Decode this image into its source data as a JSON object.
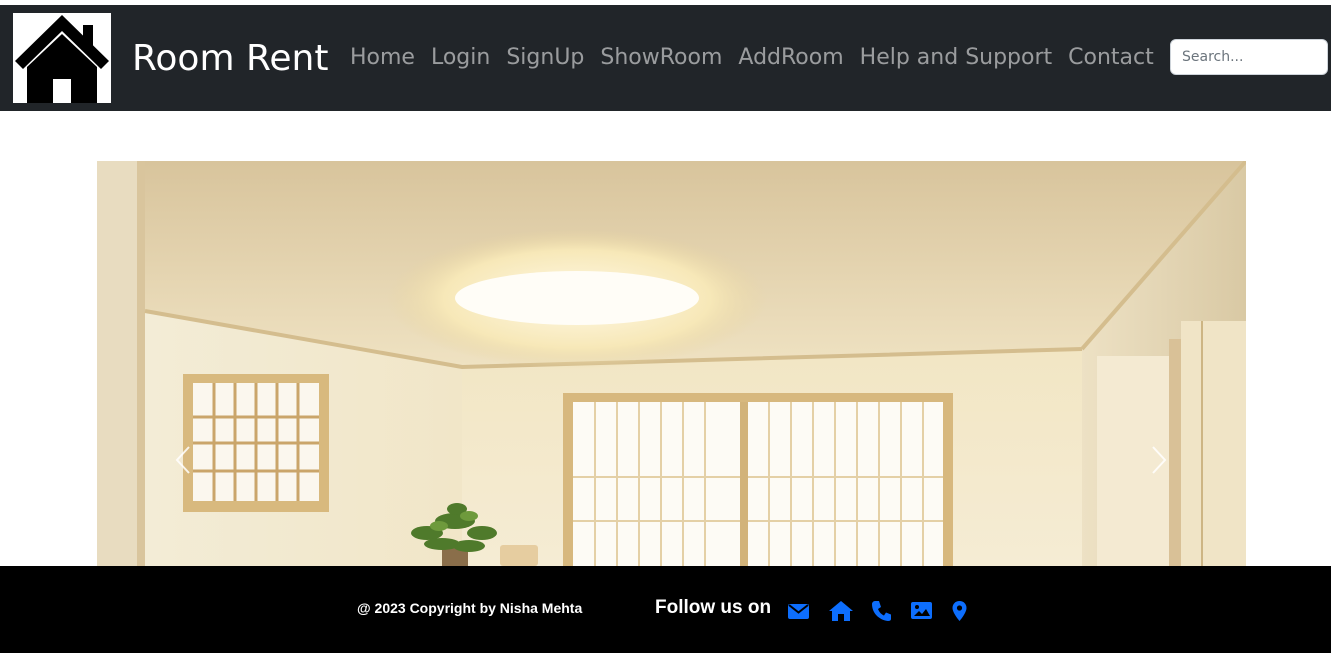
{
  "brand": {
    "title": "Room Rent",
    "logo_icon": "house-icon"
  },
  "nav": {
    "items": [
      {
        "label": "Home"
      },
      {
        "label": "Login"
      },
      {
        "label": "SignUp"
      },
      {
        "label": "ShowRoom"
      },
      {
        "label": "AddRoom"
      },
      {
        "label": "Help and Support"
      },
      {
        "label": "Contact"
      }
    ]
  },
  "search": {
    "placeholder": "Search..."
  },
  "carousel": {
    "image": "room-interior-image",
    "prev_icon": "chevron-left-icon",
    "next_icon": "chevron-right-icon"
  },
  "footer": {
    "copyright": "@ 2023 Copyright by Nisha Mehta",
    "follow_label": "Follow us on",
    "social_icons": [
      "envelope-icon",
      "home-icon",
      "phone-icon",
      "image-icon",
      "location-pin-icon"
    ]
  },
  "colors": {
    "navbar_bg": "#212529",
    "footer_bg": "#000000",
    "social_icon": "#0d6efd",
    "nav_link": "rgba(255,255,255,0.55)"
  }
}
